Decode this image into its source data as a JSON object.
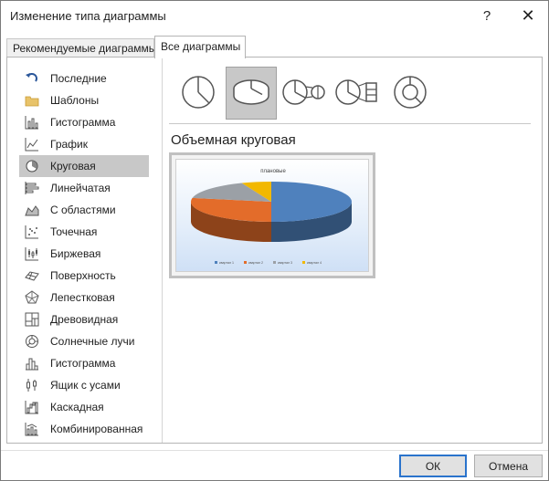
{
  "window": {
    "title": "Изменение типа диаграммы",
    "help_glyph": "?",
    "close_glyph": "✕"
  },
  "tabs": [
    {
      "label": "Рекомендуемые диаграммы",
      "active": false
    },
    {
      "label": "Все диаграммы",
      "active": true
    }
  ],
  "sidebar": {
    "items": [
      {
        "label": "Последние",
        "icon": "recent-icon",
        "selected": false
      },
      {
        "label": "Шаблоны",
        "icon": "folder-icon",
        "selected": false
      },
      {
        "label": "Гистограмма",
        "icon": "column-chart-icon",
        "selected": false
      },
      {
        "label": "График",
        "icon": "line-chart-icon",
        "selected": false
      },
      {
        "label": "Круговая",
        "icon": "pie-chart-icon",
        "selected": true
      },
      {
        "label": "Линейчатая",
        "icon": "bar-chart-icon",
        "selected": false
      },
      {
        "label": "С областями",
        "icon": "area-chart-icon",
        "selected": false
      },
      {
        "label": "Точечная",
        "icon": "scatter-chart-icon",
        "selected": false
      },
      {
        "label": "Биржевая",
        "icon": "stock-chart-icon",
        "selected": false
      },
      {
        "label": "Поверхность",
        "icon": "surface-chart-icon",
        "selected": false
      },
      {
        "label": "Лепестковая",
        "icon": "radar-chart-icon",
        "selected": false
      },
      {
        "label": "Древовидная",
        "icon": "treemap-chart-icon",
        "selected": false
      },
      {
        "label": "Солнечные лучи",
        "icon": "sunburst-chart-icon",
        "selected": false
      },
      {
        "label": "Гистограмма",
        "icon": "histogram-chart-icon",
        "selected": false
      },
      {
        "label": "Ящик с усами",
        "icon": "box-whisker-chart-icon",
        "selected": false
      },
      {
        "label": "Каскадная",
        "icon": "waterfall-chart-icon",
        "selected": false
      },
      {
        "label": "Комбинированная",
        "icon": "combo-chart-icon",
        "selected": false
      }
    ]
  },
  "subtypes": [
    {
      "icon": "pie-2d-icon",
      "selected": false
    },
    {
      "icon": "pie-3d-icon",
      "selected": true
    },
    {
      "icon": "pie-of-pie-icon",
      "selected": false
    },
    {
      "icon": "bar-of-pie-icon",
      "selected": false
    },
    {
      "icon": "doughnut-icon",
      "selected": false
    }
  ],
  "selected_type_label": "Объемная круговая",
  "chart_data": {
    "type": "pie",
    "title": "плановые",
    "categories": [
      "квартал 1",
      "квартал 2",
      "квартал 3",
      "квартал 4"
    ],
    "values": [
      50,
      28,
      16,
      6
    ],
    "colors": [
      "#4f81bd",
      "#e36c2a",
      "#9ba0a6",
      "#f2b800"
    ]
  },
  "buttons": {
    "ok": "ОК",
    "cancel": "Отмена"
  },
  "colors": {
    "selected_bg": "#c8c8c8",
    "accent": "#2a73cc"
  }
}
